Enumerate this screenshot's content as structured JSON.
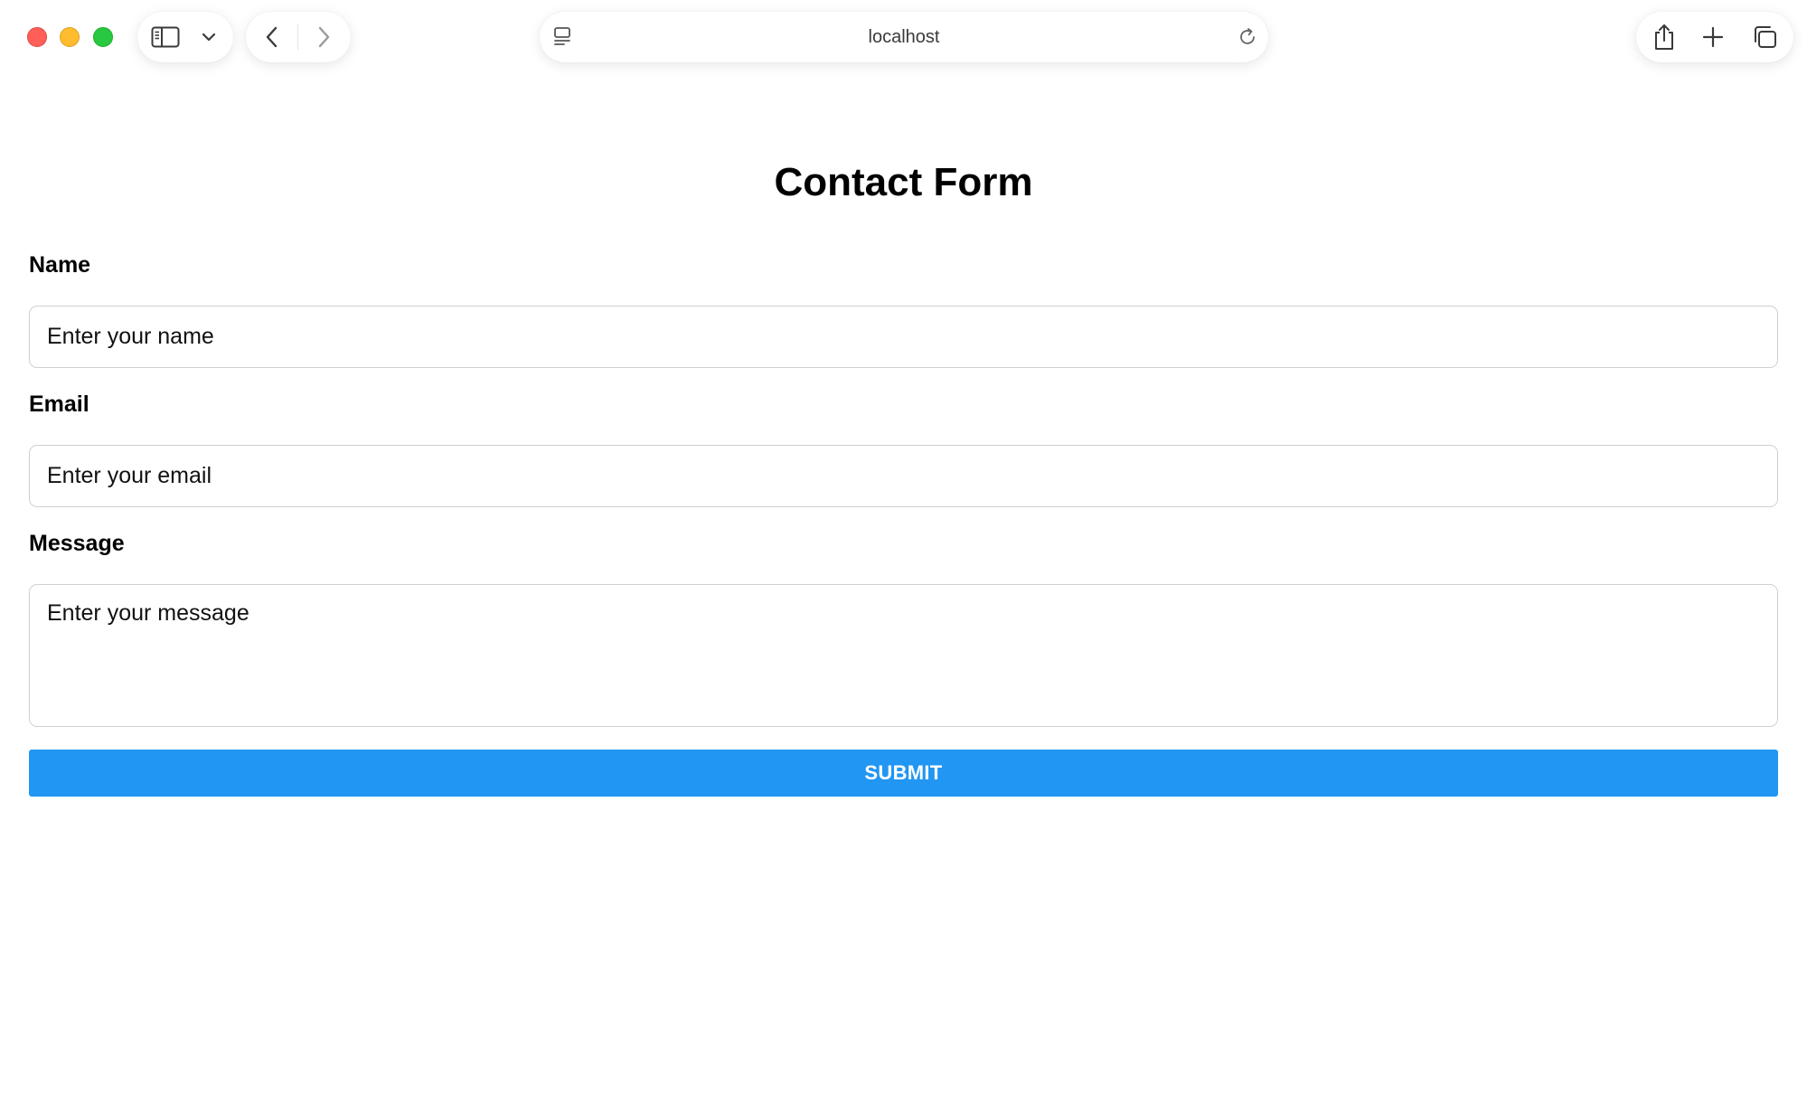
{
  "browser": {
    "address": "localhost",
    "icons": {
      "sidebar": "sidebar-icon",
      "chevron": "chevron-down-icon",
      "back": "back-arrow-icon",
      "forward": "forward-arrow-icon",
      "reader": "page-menu-icon",
      "reload": "reload-icon",
      "share": "share-icon",
      "new_tab": "plus-icon",
      "tabs": "tab-overview-icon"
    },
    "traffic_colors": {
      "close": "#ff5f57",
      "minimize": "#febc2e",
      "maximize": "#28c840"
    }
  },
  "form": {
    "title": "Contact Form",
    "fields": [
      {
        "label": "Name",
        "placeholder": "Enter your name",
        "value": ""
      },
      {
        "label": "Email",
        "placeholder": "Enter your email",
        "value": ""
      },
      {
        "label": "Message",
        "placeholder": "Enter your message",
        "value": ""
      }
    ],
    "submit_label": "SUBMIT",
    "accent_color": "#2196f3"
  }
}
